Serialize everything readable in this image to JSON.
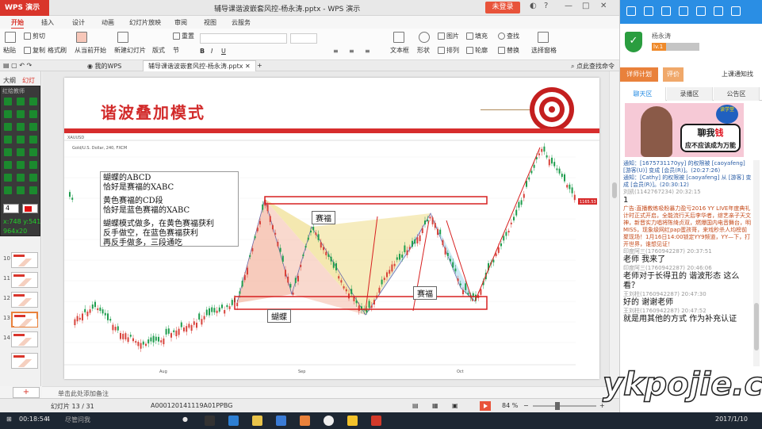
{
  "window": {
    "app_button": "WPS 演示",
    "doc_title": "辅导课谐波嵌套风控-杨永涛.pptx - WPS 演示",
    "login_label": "未登录"
  },
  "ribbon_tabs": [
    "开始",
    "插入",
    "设计",
    "动画",
    "幻灯片放映",
    "审阅",
    "视图",
    "云服务"
  ],
  "ribbon": {
    "paste": "粘贴",
    "cut": "剪切",
    "copy": "复制",
    "format_painter": "格式刷",
    "from_current": "从当前开始",
    "new_slide": "新建幻灯片",
    "layout": "版式",
    "section": "节",
    "reset": "重置",
    "picture": "图片",
    "fill": "填充",
    "find": "查找",
    "textbox": "文本框",
    "shape": "形状",
    "arrange": "排列",
    "outline": "轮廓",
    "replace": "替换",
    "select_pane": "选择窗格"
  },
  "doc_tabs": {
    "my_wps": "我的WPS",
    "current": "辅导课谐波嵌套风控-杨永涛.pptx",
    "help": "点此查找命令"
  },
  "left_pane": {
    "outline_tab": "大纲",
    "slides_tab": "幻灯片",
    "thumb_numbers": [
      "10",
      "11",
      "12",
      "13",
      "14"
    ],
    "new_slide_glyph": "+"
  },
  "pen_tool": {
    "title": "红绘教师",
    "width": "4",
    "coord_x": "x:748  y:541",
    "coord_size": "964x20"
  },
  "slide": {
    "title": "谐波叠加模式",
    "note_lines": [
      "蝴蝶的ABCD",
      "恰好是赛福的XABC",
      "",
      "黄色赛福的CD段",
      "恰好是蓝色赛福的XABC",
      "",
      "蝴蝶模式做多，在黄色赛福获利",
      "反手做空，在蓝色赛福获利",
      "再反手做多，三段通吃"
    ],
    "label_saifu1": "赛福",
    "label_saifu2": "赛福",
    "label_hudie": "蝴蝶",
    "chart_header": "Gold/U.S. Dollar, 240, FXCM",
    "symbol": "XAUUSD",
    "price_tag": "1165.53",
    "x_ticks": [
      "Aug",
      "Sep",
      "Oct"
    ]
  },
  "notes_placeholder": "单击此处添加备注",
  "status": {
    "slide_counter": "幻灯片 13 / 31",
    "code": "A000120141119A01PPBG",
    "zoom": "84 %"
  },
  "side_panel": {
    "username": "杨永涛",
    "level": "lv.1",
    "btn_plan": "详师计划",
    "btn_review": "评价",
    "btn_notice": "上课通知找",
    "tabs": [
      "聊天区",
      "录播区",
      "公告区"
    ],
    "ad_bubble_line1": "聊我",
    "ad_bubble_highlight": "钱",
    "ad_bubble_line2": "应不应该成为万能",
    "ad_badge": "读学堂",
    "chat": [
      {
        "kind": "sys",
        "text": "通知：[1675731170yy] 的权限被 [caoyafeng] [游客(U)] 变成 [会员(R)]。(20:27:26)"
      },
      {
        "kind": "sys",
        "text": "通知：[Cathy] 的权限被 [caoyafeng] 从 [游客] 变成 [会员(R)]。(20:30:12)"
      },
      {
        "kind": "meta",
        "text": "刘凯(1142767234) 20:32:15"
      },
      {
        "kind": "msg",
        "text": "1"
      },
      {
        "kind": "ad",
        "text": "广告:直播教练吸粉暴力盈亏2016 YY LIVE年度典礼计时正式开启，全能流行天后李华者，综艺亲子天文神，新晋实力唱将陈绮贞双，燃爆国内电音舞台，明MISS，现象级网红pap蛋孩哥，来戏秒杀人均榜前聚现场！1月16日14:00锁定YY9频道，YY—下，打开世界，谁想见证！"
      },
      {
        "kind": "meta",
        "text": "印度阿三(1760942287) 20:37:51"
      },
      {
        "kind": "msg",
        "text": "老师  我来了"
      },
      {
        "kind": "meta",
        "text": "印度阿三(1760942287) 20:46:06"
      },
      {
        "kind": "msg",
        "text": "老师对于长得丑的  谐波形态  这么看？"
      },
      {
        "kind": "meta",
        "text": "王刘柱(1760942287) 20:47:30"
      },
      {
        "kind": "msg",
        "text": "好的  谢谢老师"
      },
      {
        "kind": "meta",
        "text": "王刘柱(1760942287) 20:47:52"
      },
      {
        "kind": "msg",
        "text": "就是用其他的方式  作为补充认证"
      }
    ]
  },
  "taskbar": {
    "timer": "00:18:54",
    "count": "4",
    "search": "尽管问我",
    "date": "2017/1/10"
  },
  "watermark": "ykpojie.com",
  "colors": {
    "wps_red": "#d9352b",
    "accent_blue": "#2a8ee4",
    "saifu_yellow": "#f2e4a2",
    "saifu_blue": "#bfe3f2",
    "hudie_red": "#f4b9a5",
    "candle_green": "#1f9d4e",
    "candle_red": "#d8433b"
  }
}
